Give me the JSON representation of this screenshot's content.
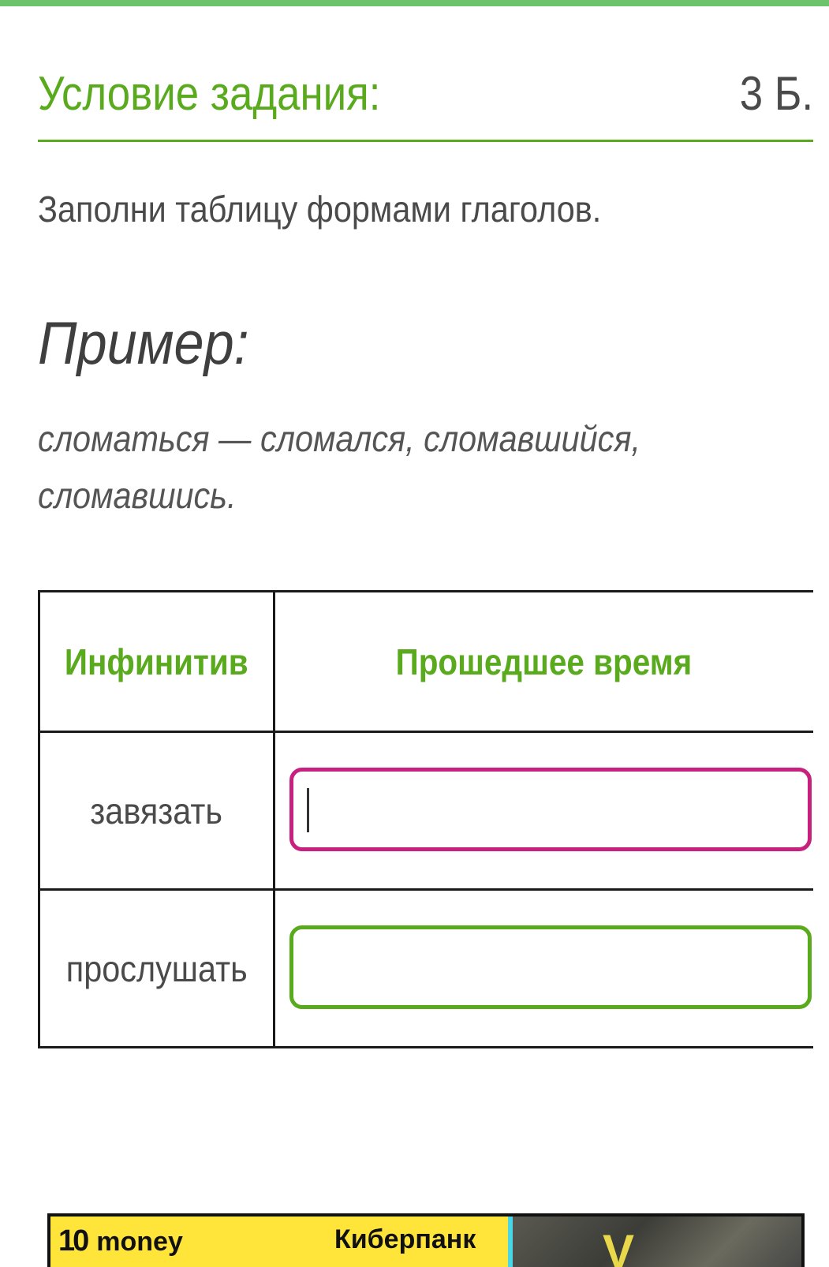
{
  "task": {
    "title": "Условие задания:",
    "points": "3 Б."
  },
  "instruction": "Заполни таблицу формами глаголов.",
  "example": {
    "heading": "Пример:",
    "line1": "сломаться — сломался, сломавшийся,",
    "line2": "сломавшись."
  },
  "table": {
    "headers": [
      "Инфинитив",
      "Прошедшее время"
    ],
    "rows": [
      {
        "infinitive": "завязать",
        "answer": "",
        "active": true
      },
      {
        "infinitive": "прослушать",
        "answer": "",
        "active": false
      }
    ]
  },
  "ad": {
    "logo_number": "10",
    "logo_text": "money",
    "text": "Киберпанк",
    "image_mark": "V"
  },
  "colors": {
    "accent_green": "#5aaa1e",
    "active_border": "#c8207e",
    "top_bar": "#6cc36c",
    "ad_yellow": "#ffe43a"
  }
}
